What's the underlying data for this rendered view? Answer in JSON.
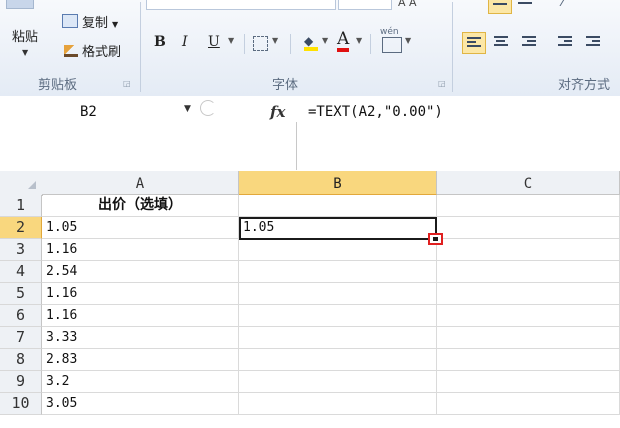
{
  "ribbon": {
    "clipboard": {
      "paste_label": "粘贴",
      "copy_label": "复制",
      "format_painter_label": "格式刷",
      "group_label": "剪贴板"
    },
    "font": {
      "bold": "B",
      "italic": "I",
      "underline": "U",
      "group_label": "字体",
      "phonetic_label": "wén"
    },
    "alignment": {
      "group_label": "对齐方式"
    }
  },
  "formula_bar": {
    "name_box": "B2",
    "fx_label": "fx",
    "formula": "=TEXT(A2,\"0.00\")"
  },
  "sheet": {
    "columns": [
      "A",
      "B",
      "C"
    ],
    "active_column": "B",
    "active_row": "2",
    "rows": [
      {
        "num": "1",
        "a": "出价（选填）",
        "b": ""
      },
      {
        "num": "2",
        "a": "1.05",
        "b": "1.05"
      },
      {
        "num": "3",
        "a": "1.16",
        "b": ""
      },
      {
        "num": "4",
        "a": "2.54",
        "b": ""
      },
      {
        "num": "5",
        "a": "1.16",
        "b": ""
      },
      {
        "num": "6",
        "a": "1.16",
        "b": ""
      },
      {
        "num": "7",
        "a": "3.33",
        "b": ""
      },
      {
        "num": "8",
        "a": "2.83",
        "b": ""
      },
      {
        "num": "9",
        "a": "3.2",
        "b": ""
      },
      {
        "num": "10",
        "a": "3.05",
        "b": ""
      }
    ]
  },
  "colors": {
    "selection_header": "#f9d77e",
    "fill_handle_highlight": "#e02020",
    "header_bg": "#eef1f5"
  }
}
